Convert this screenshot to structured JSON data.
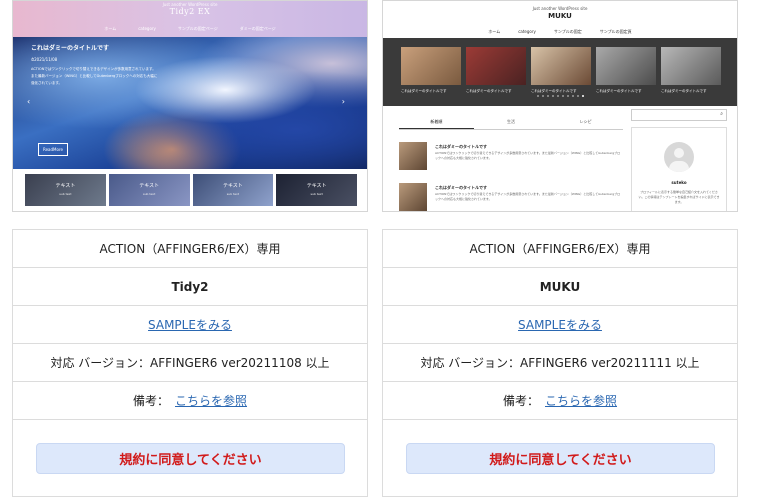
{
  "themes": [
    {
      "preview": {
        "tagline": "Just another WordPress site",
        "logo": "Tidy2 EX",
        "nav": [
          "ホーム",
          "category",
          "サンプルの固定ページ",
          "ダミーの固定ページ"
        ],
        "post_title": "これはダミーのタイトルです",
        "date": "2021/11/08",
        "desc": "ACTIONではワンクリックで切り替えできるデザインが多数用意されています。また最新バージョン（WING）と比較してGutenbergブロックへの対応も大幅に強化されています。",
        "read_more": "ReadMore",
        "thumbs": [
          {
            "title": "テキスト",
            "sub": "sub text"
          },
          {
            "title": "テキスト",
            "sub": "sub text"
          },
          {
            "title": "テキスト",
            "sub": "sub text"
          },
          {
            "title": "テキスト",
            "sub": "sub text"
          }
        ]
      },
      "edition": "ACTION（AFFINGER6/EX）専用",
      "name": "Tidy2",
      "sample_link": "SAMPLEをみる",
      "version": "対応 バージョン：AFFINGER6 ver20211108 以上",
      "note_label": "備考：",
      "note_link": "こちらを参照",
      "agree_button": "規約に同意してください"
    },
    {
      "preview": {
        "tagline": "Just another WordPress site",
        "logo": "MUKU",
        "nav": [
          "ホーム",
          "category",
          "サンプルの固定",
          "サンプルの固定頁"
        ],
        "slide_caption": "これはダミーのタイトルです",
        "tabs": [
          "新着順",
          "生活",
          "レシピ"
        ],
        "post_title": "これはダミーのタイトルです",
        "post_desc": "ACTIONではワンクリックで切り替えできるデザインが多数用意されています。また最新バージョン（WING）と比較してGutenbergブロックへの対応も大幅に強化されています。",
        "profile_name": "suteko",
        "profile_desc": "プロフィールに表示する簡単な自己紹介文を入れてください。この情報はテンプレートを編集すればサイドに表示できます。"
      },
      "edition": "ACTION（AFFINGER6/EX）専用",
      "name": "MUKU",
      "sample_link": "SAMPLEをみる",
      "version": "対応 バージョン：AFFINGER6 ver20211111 以上",
      "note_label": "備考：",
      "note_link": "こちらを参照",
      "agree_button": "規約に同意してください"
    }
  ],
  "colors": {
    "link": "#2a67b1",
    "agree_text": "#d11a1a",
    "agree_bg": "#dde8fb",
    "border": "#dcdcdc"
  }
}
